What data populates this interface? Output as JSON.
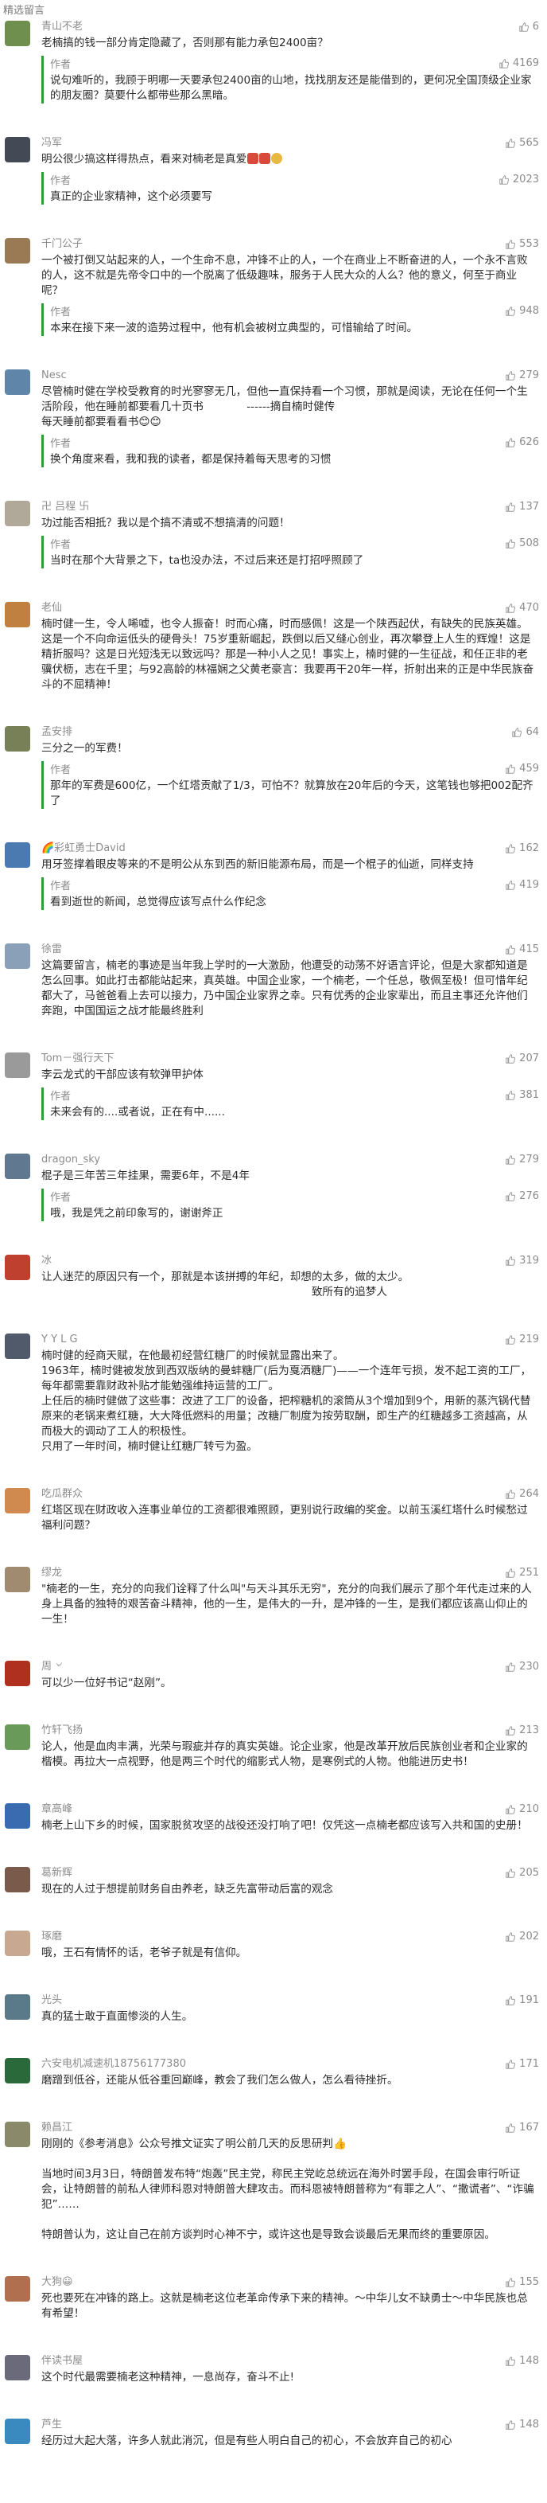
{
  "header": {
    "title": "精选留言"
  },
  "colors": {
    "accent": "#2e9c3a",
    "text": "#2b2b2b",
    "muted": "#8c8c8c"
  },
  "comments": [
    {
      "name": "青山不老",
      "likes": "6",
      "text": "老楠搞的钱一部分肯定隐藏了，否则那有能力承包2400亩？",
      "author_reply": "说句难听的，我顾于明哪一天要承包2400亩的山地，找找朋友还是能借到的，更何况全国顶级企业家的朋友圈？莫要什么都带些那么黑暗。",
      "reply_likes": "4169",
      "avatar": "#6f8f4f"
    },
    {
      "name": "冯军",
      "likes": "565",
      "text": "明公很少搞这样得热点，看来对楠老是真爱",
      "author_reply": "真正的企业家精神，这个必须要写",
      "reply_likes": "2023",
      "avatar": "#444a55",
      "emoji": true
    },
    {
      "name": "千门公子",
      "likes": "553",
      "text": "一个被打倒又站起来的人，一个生命不息，冲锋不止的人，一个在商业上不断奋进的人，一个永不言败的人，这不就是先帝令口中的一个脱离了低级趣味，服务于人民大众的人么？他的意义，何至于商业呢？",
      "author_reply": "本来在接下来一波的造势过程中，他有机会被树立典型的，可惜输给了时间。",
      "reply_likes": "948",
      "avatar": "#9a7a55"
    },
    {
      "name": "Nesc",
      "likes": "279",
      "text": "尽管楠时健在学校受教育的时光寥寥无几，但他一直保持看一个习惯，那就是阅读，无论在任何一个生活阶段，他在睡前都要看几十页书　　　　------摘自楠时健传\n每天睡前都要看看书😊😊",
      "author_reply": "换个角度来看，我和我的读者，都是保持着每天思考的习惯",
      "reply_likes": "626",
      "avatar": "#5f86a8"
    },
    {
      "name": "卍 吕程 卐",
      "likes": "137",
      "text": "功过能否相抵？我以是个搞不清或不想搞清的问题！",
      "author_reply": "当时在那个大背景之下，ta也没办法，不过后来还是打招呼照顾了",
      "reply_likes": "508",
      "avatar": "#b0a898"
    },
    {
      "name": "老仙",
      "likes": "470",
      "text": "楠时健一生，令人唏嘘，也令人振奋！时而心痛，时而感佩！这是一个陕西起伏，有缺失的民族英雄。这是一个不向命运低头的硬骨头！75岁重新崛起，跌倒以后又缝心创业，再次攀登上人生的辉煌！这是精折服吗？这是日光短浅无以致远吗？那是一种小人之见！事实上，楠时健的一生征战，和任正非的老骥伏枥，志在千里；与92高龄的林福娴之父黄老豪言：我要再干20年一样，折射出来的正是中华民族奋斗的不屈精神！",
      "author_reply": "",
      "reply_likes": "",
      "avatar": "#c08040"
    },
    {
      "name": "孟安排",
      "likes": "64",
      "text": "三分之一的军费！",
      "author_reply": "那年的军费是600亿，一个红塔贡献了1/3，可怕不？就算放在20年后的今天，这笔钱也够把002配齐了",
      "reply_likes": "459",
      "avatar": "#788058"
    },
    {
      "name": "🌈彩虹勇士David",
      "likes": "162",
      "text": "用牙签撑着眼皮等来的不是明公从东到西的新旧能源布局，而是一个棍子的仙逝，同样支持",
      "author_reply": "看到逝世的新闻，总觉得应该写点什么作纪念",
      "reply_likes": "419",
      "avatar": "#4a7ab0"
    },
    {
      "name": "徐雷",
      "likes": "415",
      "text": "这篇要留言，楠老的事迹是当年我上学时的一大激励，他遭受的动荡不好语言评论，但是大家都知道是怎么回事。如此打击都能站起来，真英雄。中国企业家，一个楠老，一个任总，敬佩至极！但可惜年纪都大了，马爸爸看上去可以接力，乃中国企业家界之幸。只有优秀的企业家辈出，而且主事还允许他们奔跑，中国国运之战才能最终胜利",
      "author_reply": "",
      "reply_likes": "",
      "avatar": "#8aa0b8"
    },
    {
      "name": "Tom－强行天下",
      "likes": "207",
      "text": "李云龙式的干部应该有软弹甲护体",
      "author_reply": "未来会有的....或者说，正在有中......",
      "reply_likes": "381",
      "avatar": "#9a9a9a"
    },
    {
      "name": "dragon_sky",
      "likes": "279",
      "text": "棍子是三年苦三年挂果，需要6年，不是4年",
      "author_reply": "哦，我是凭之前印象写的，谢谢斧正",
      "reply_likes": "276",
      "avatar": "#607890"
    },
    {
      "name": "冰",
      "likes": "319",
      "text": "让人迷茫的原因只有一个，那就是本该拼搏的年纪，却想的太多，做的太少。\n　　　　　　　　　　　　　　　　　　　　　　　　　致所有的追梦人",
      "author_reply": "",
      "reply_likes": "",
      "avatar": "#c04030"
    },
    {
      "name": "Y Y L G",
      "likes": "219",
      "text": "楠时健的经商天赋，在他最初经营红糖厂的时候就显露出来了。\n1963年，楠时健被发放到西双版纳的曼蚌糖厂(后为戛洒糖厂)——一个连年亏损，发不起工资的工厂，每年都需要靠财政补贴才能勉强维持运营的工厂。\n上任后的楠时健做了这些事：改进了工厂的设备，把榨糖机的滚筒从3个增加到9个，用新的蒸汽锅代替原来的老锅来煮红糖，大大降低燃料的用量；改糖厂制度为按劳取酬，即生产的红糖越多工资越高，从而极大的调动了工人的积极性。\n只用了一年时间，楠时健让红糖厂转亏为盈。",
      "author_reply": "",
      "reply_likes": "",
      "avatar": "#505a6a"
    },
    {
      "name": "吃瓜群众",
      "likes": "264",
      "text": "红塔区现在财政收入连事业单位的工资都很难照顾，更别说行政编的奖金。以前玉溪红塔什么时候愁过福利问题？",
      "author_reply": "",
      "reply_likes": "",
      "avatar": "#d08a50"
    },
    {
      "name": "缪龙",
      "likes": "251",
      "text": "\"楠老的一生，充分的向我们诠释了什么叫\"与天斗其乐无穷\"，充分的向我们展示了那个年代走过来的人身上具备的独特的艰苦奋斗精神，他的一生，是伟大的一升，是冲锋的一生，是我们都应该高山仰止的一生！",
      "author_reply": "",
      "reply_likes": "",
      "avatar": "#a08a70"
    },
    {
      "name": "周 ৺",
      "likes": "230",
      "text": "可以少一位好书记“赵刚”。",
      "author_reply": "",
      "reply_likes": "",
      "avatar": "#b03020"
    },
    {
      "name": "竹轩飞扬",
      "likes": "213",
      "text": "论人，他是血肉丰满，光荣与瑕疵并存的真实英雄。论企业家，他是改革开放后民族创业者和企业家的楷模。再拉大一点视野，他是两三个时代的缩影式人物，是寒例式的人物。他能进历史书！",
      "author_reply": "",
      "reply_likes": "",
      "avatar": "#6a9a5a"
    },
    {
      "name": "章高峰",
      "likes": "210",
      "text": "楠老上山下乡的时候，国家脱贫攻坚的战役还没打响了吧！仅凭这一点楠老都应该写入共和国的史册！",
      "author_reply": "",
      "reply_likes": "",
      "avatar": "#3a6ab0"
    },
    {
      "name": "葛新辉",
      "likes": "205",
      "text": "现在的人过于想提前财务自由养老，缺乏先富带动后富的观念",
      "author_reply": "",
      "reply_likes": "",
      "avatar": "#7a5a4a"
    },
    {
      "name": "琢磨",
      "likes": "202",
      "text": "哦，王石有情怀的话，老爷子就是有信仰。",
      "author_reply": "",
      "reply_likes": "",
      "avatar": "#c8a890"
    },
    {
      "name": "光头",
      "likes": "191",
      "text": "真的猛士敢于直面惨淡的人生。",
      "author_reply": "",
      "reply_likes": "",
      "avatar": "#5a7a8a"
    },
    {
      "name": "六安电机减速机18756177380",
      "likes": "171",
      "text": "磨蹭到低谷，还能从低谷重回巅峰，教会了我们怎么做人，怎么看待挫折。",
      "author_reply": "",
      "reply_likes": "",
      "avatar": "#2a6a3a"
    },
    {
      "name": "赖昌江",
      "likes": "167",
      "text": "刚刚的《参考消息》公众号推文证实了明公前几天的反思研判👍\n\n当地时间3月3日，特朗普发布特“炮轰”民主党，称民主党屹总统远在海外时罢手段，在国会审行听证会，让特朗普的前私人律师科恩对特朗普大肆攻击。而科恩被特朗普称为“有罪之人”、“撒谎者”、“诈骗犯”……\n\n特朗普认为，这让自己在前方谈判时心神不宁，或许这也是导致会谈最后无果而终的重要原因。",
      "author_reply": "",
      "reply_likes": "",
      "avatar": "#8a8a6a"
    },
    {
      "name": "大狗😀",
      "likes": "155",
      "text": "死也要死在冲锋的路上。这就是楠老这位老革命传承下来的精神。～中华儿女不缺勇士～中华民族也总有希望！",
      "author_reply": "",
      "reply_likes": "",
      "avatar": "#b07050"
    },
    {
      "name": "伴读书屋",
      "likes": "148",
      "text": "这个时代最需要楠老这种精神，一息尚存，奋斗不止!",
      "author_reply": "",
      "reply_likes": "",
      "avatar": "#6a6a7a"
    },
    {
      "name": "芦生",
      "likes": "148",
      "text": "经历过大起大落，许多人就此消沉，但是有些人明白自己的初心，不会放弃自己的初心",
      "author_reply": "",
      "reply_likes": "",
      "avatar": "#3a8ac0"
    }
  ]
}
